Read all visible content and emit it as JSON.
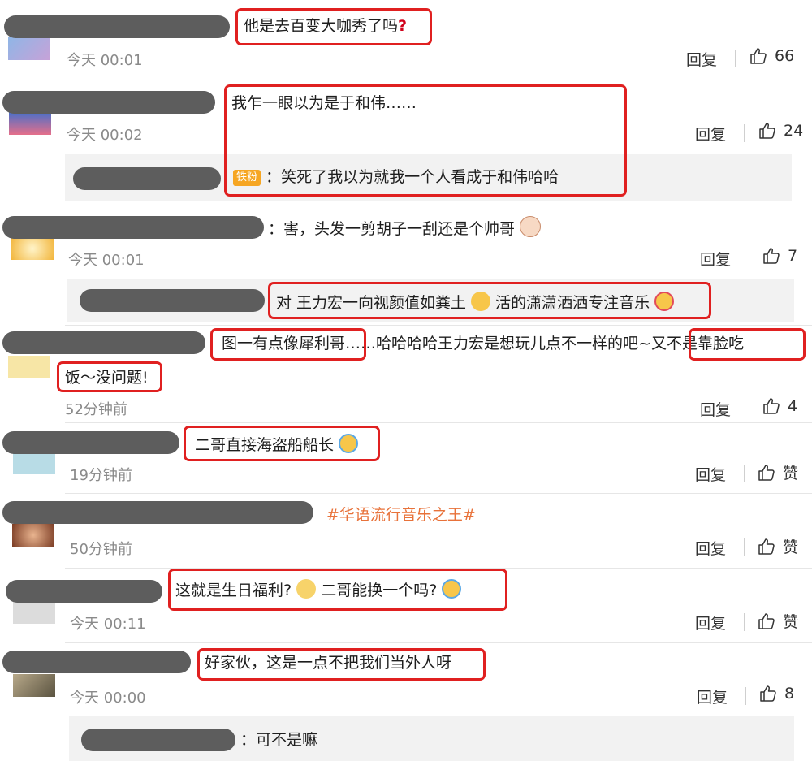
{
  "comments": [
    {
      "text": "他是去百变大咖秀了吗",
      "qmark": "?",
      "time": "今天 00:01",
      "reply": "回复",
      "likes": "66"
    },
    {
      "text": "我乍一眼以为是于和伟……",
      "time": "今天 00:02",
      "reply": "回复",
      "likes": "24",
      "sub": {
        "badge": "铁粉",
        "text": "：笑死了我以为就我一个人看成于和伟哈哈"
      }
    },
    {
      "text": "：害，头发一剪胡子一刮还是个帅哥",
      "time": "今天 00:01",
      "reply": "回复",
      "likes": "7",
      "sub": {
        "text_a": "对 王力宏一向视颜值如粪土",
        "text_b": "活的潇潇洒洒专注音乐"
      }
    },
    {
      "part1": "图一有点像犀利哥",
      "part2": "……哈哈哈哈王力宏是想玩儿点不一样的吧~",
      "part3": "又不是靠脸吃",
      "part4": "饭～没问题!",
      "time": "52分钟前",
      "reply": "回复",
      "likes": "4"
    },
    {
      "text": "二哥直接海盗船船长",
      "time": "19分钟前",
      "reply": "回复",
      "likes": "赞"
    },
    {
      "text": "#华语流行音乐之王#",
      "time": "50分钟前",
      "reply": "回复",
      "likes": "赞"
    },
    {
      "text_a": "这就是生日福利?",
      "text_b": "二哥能换一个吗?",
      "time": "今天 00:11",
      "reply": "回复",
      "likes": "赞"
    },
    {
      "text": "好家伙，这是一点不把我们当外人呀",
      "time": "今天 00:00",
      "reply": "回复",
      "likes": "8",
      "sub": {
        "text": "：可不是嘛"
      }
    }
  ],
  "icons": {
    "like": "thumbs-up-icon",
    "laugh": "laughing-crying-emoji",
    "smirk": "smirk-emoji",
    "love": "heart-eyes-emoji",
    "ox": "ox-face-emoji"
  },
  "colors": {
    "highlight": "#e02020",
    "hashtag": "#e8723a",
    "badge": "#f6a623"
  }
}
